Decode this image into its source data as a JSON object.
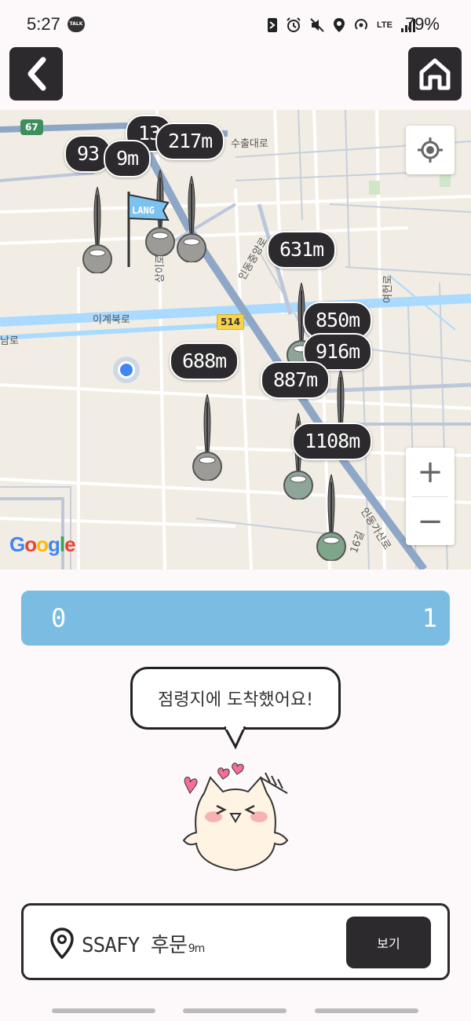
{
  "status": {
    "time": "5:27",
    "talk_badge": "TALK",
    "network": "LTE",
    "battery": "79%"
  },
  "map": {
    "labels": [
      "13",
      "217m",
      "93",
      "9m",
      "631m",
      "850m",
      "916m",
      "688m",
      "887m",
      "1108m"
    ],
    "roads": {
      "r1": "수출대로",
      "r2": "인동중앙로",
      "r3": "상이로",
      "r4": "이계북로",
      "r5": "남로",
      "r6": "여헌로",
      "r7": "인동가산로",
      "r8": "16길"
    },
    "route_shield": "514",
    "highway_shield": "67",
    "flag_text": "LANG",
    "google": [
      "G",
      "o",
      "o",
      "g",
      "l",
      "e"
    ],
    "zoom_in": "+",
    "zoom_out": "−"
  },
  "progress": {
    "min": "0",
    "max": "1",
    "value_fraction": 1.0
  },
  "bubble": {
    "text": "점령지에 도착했어요!"
  },
  "location": {
    "name": "SSAFY 후문",
    "distance": "9m",
    "view_label": "보기"
  },
  "colors": {
    "dark": "#2c2a2c",
    "progress": "#7bbde2",
    "user_dot": "#4285f4"
  }
}
